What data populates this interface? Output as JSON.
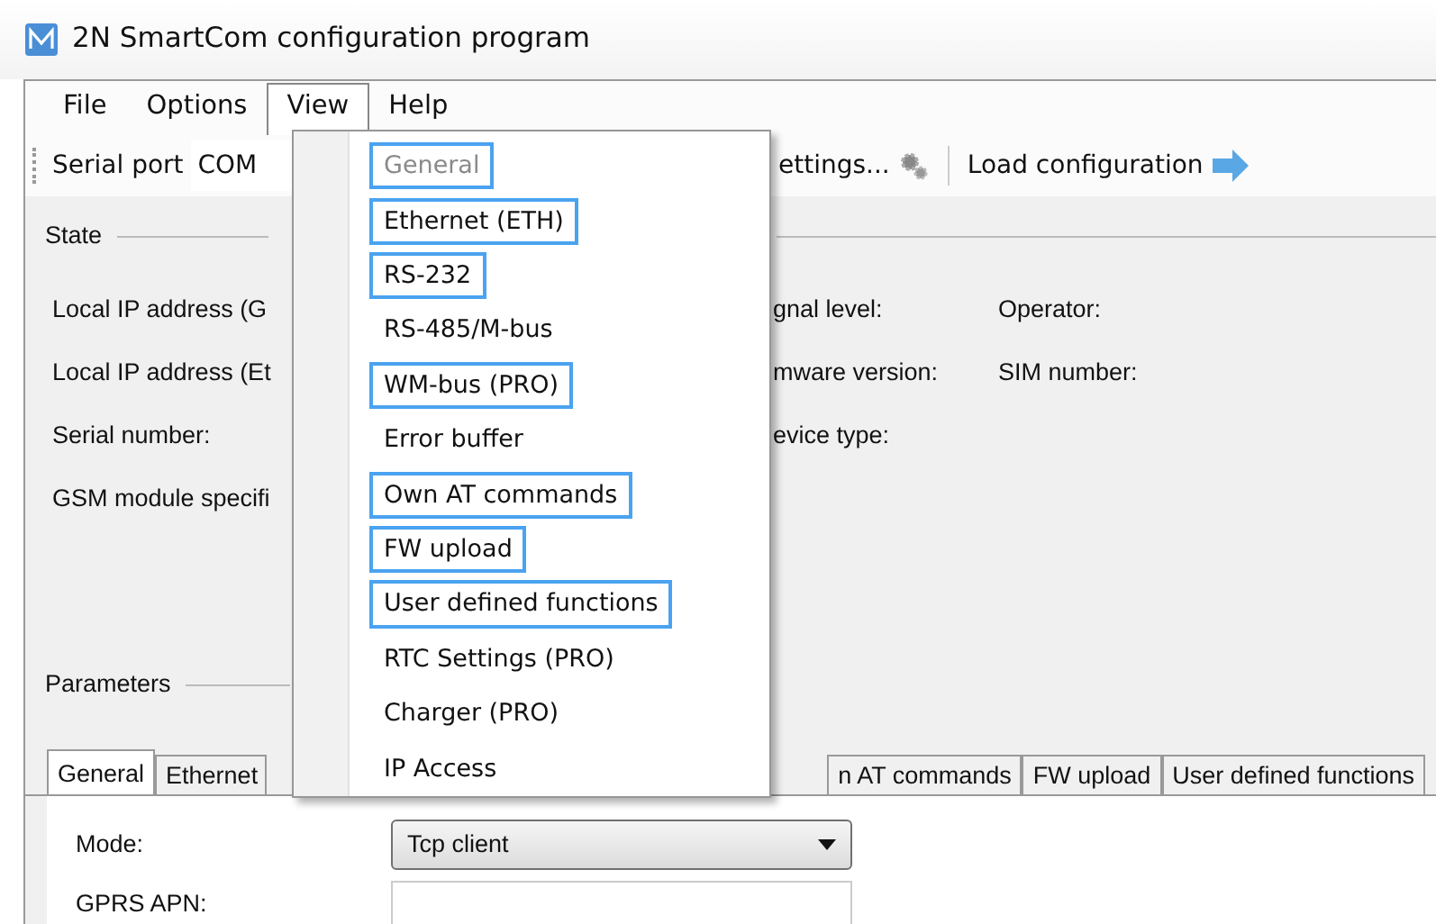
{
  "window": {
    "title": "2N SmartCom configuration program"
  },
  "menu_bar": [
    {
      "label": "File",
      "selected": false
    },
    {
      "label": "Options",
      "selected": false
    },
    {
      "label": "View",
      "selected": true
    },
    {
      "label": "Help",
      "selected": false
    }
  ],
  "view_menu": {
    "items": [
      {
        "label": "General",
        "disabled": true,
        "highlighted": true
      },
      {
        "label": "Ethernet (ETH)",
        "disabled": false,
        "highlighted": true
      },
      {
        "label": "RS-232",
        "disabled": false,
        "highlighted": true
      },
      {
        "label": "RS-485/M-bus",
        "disabled": false,
        "highlighted": false
      },
      {
        "label": "WM-bus (PRO)",
        "disabled": false,
        "highlighted": true
      },
      {
        "label": "Error buffer",
        "disabled": false,
        "highlighted": false
      },
      {
        "label": "Own AT commands",
        "disabled": false,
        "highlighted": true
      },
      {
        "label": "FW upload",
        "disabled": false,
        "highlighted": true
      },
      {
        "label": "User defined functions",
        "disabled": false,
        "highlighted": true
      },
      {
        "label": "RTC Settings (PRO)",
        "disabled": false,
        "highlighted": false
      },
      {
        "label": "Charger (PRO)",
        "disabled": false,
        "highlighted": false
      },
      {
        "label": "IP Access",
        "disabled": false,
        "highlighted": false
      }
    ]
  },
  "toolbar": {
    "serial_port_label": "Serial port",
    "serial_port_value": "COM",
    "settings_button": "ettings...",
    "load_button": "Load configuration"
  },
  "state": {
    "title": "State",
    "rows": [
      {
        "column_1": "Local IP address (G",
        "column_2": "gnal level:",
        "column_3": "Operator:"
      },
      {
        "column_1": "Local IP address (Et",
        "column_2": "mware version:",
        "column_3": "SIM number:"
      },
      {
        "column_1": "Serial number:",
        "column_2": "evice type:"
      },
      {
        "column_1": "GSM module specifi"
      }
    ]
  },
  "parameters": {
    "title": "Parameters",
    "tabs_left": [
      {
        "label": "General",
        "selected": true
      },
      {
        "label": "Ethernet",
        "selected": false
      }
    ],
    "tabs_right": [
      {
        "label": "n AT commands",
        "selected": false
      },
      {
        "label": "FW upload",
        "selected": false
      },
      {
        "label": "User defined functions",
        "selected": false
      }
    ],
    "fields": [
      {
        "label": "Mode:",
        "kind": "select",
        "value": "Tcp client"
      },
      {
        "label": "GPRS APN:",
        "kind": "text"
      }
    ]
  }
}
